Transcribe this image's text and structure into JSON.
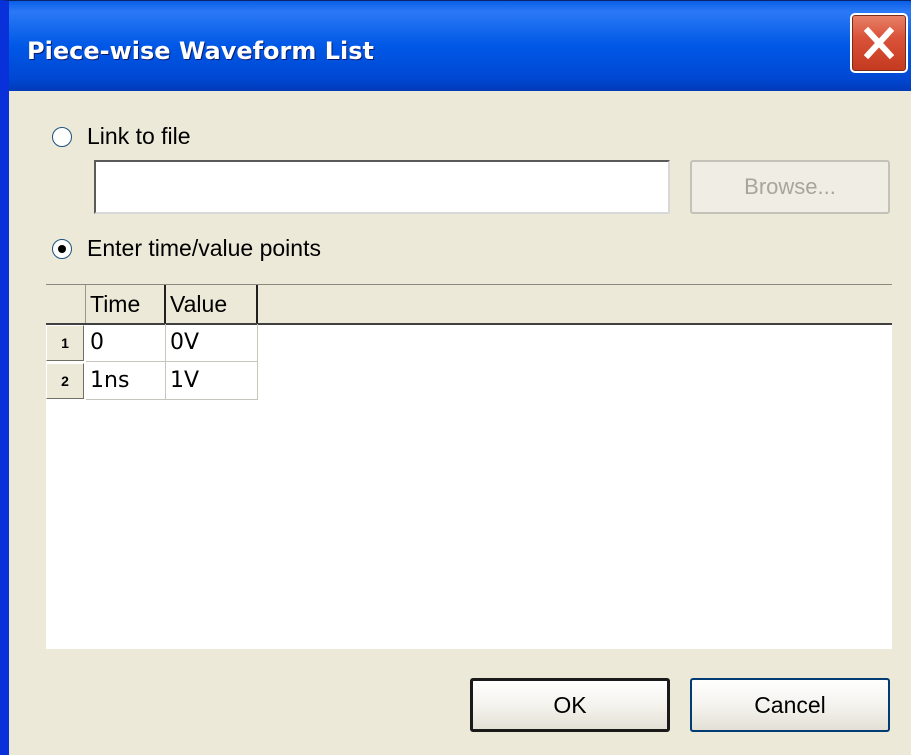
{
  "window": {
    "title": "Piece-wise Waveform List"
  },
  "options": {
    "link_to_file_label": "Link to file",
    "file_path_value": "",
    "browse_label": "Browse...",
    "enter_points_label": "Enter time/value points",
    "selected": "enter_points"
  },
  "table": {
    "columns": [
      "Time",
      "Value"
    ],
    "rows": [
      {
        "num": "1",
        "time": "0",
        "value": "0V"
      },
      {
        "num": "2",
        "time": "1ns",
        "value": "1V"
      }
    ]
  },
  "buttons": {
    "ok_label": "OK",
    "cancel_label": "Cancel"
  },
  "colors": {
    "titlebar": "#0058e6",
    "close": "#d9533a",
    "dialog_bg": "#ece9d8"
  }
}
